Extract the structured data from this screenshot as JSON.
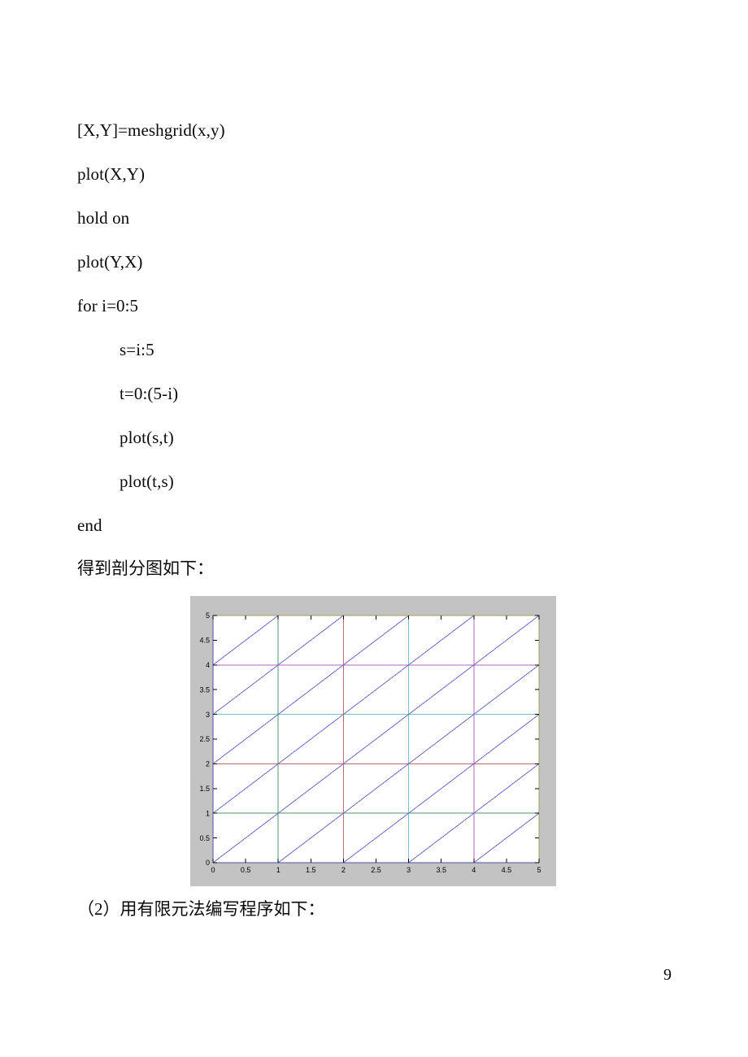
{
  "document": {
    "page_number": "9",
    "code_lines": [
      {
        "text": "[X,Y]=meshgrid(x,y)",
        "indent": 0
      },
      {
        "text": "plot(X,Y)",
        "indent": 0
      },
      {
        "text": "hold on",
        "indent": 0
      },
      {
        "text": "plot(Y,X)",
        "indent": 0
      },
      {
        "text": "for i=0:5",
        "indent": 0
      },
      {
        "text": "s=i:5",
        "indent": 1
      },
      {
        "text": "t=0:(5-i)",
        "indent": 1
      },
      {
        "text": "plot(s,t)",
        "indent": 1
      },
      {
        "text": "plot(t,s)",
        "indent": 1
      },
      {
        "text": "end",
        "indent": 0
      }
    ],
    "caption_above_figure": "得到剖分图如下：",
    "caption_below_figure": "（2）用有限元法编写程序如下："
  },
  "chart_data": {
    "type": "line",
    "title": "",
    "xlabel": "",
    "ylabel": "",
    "xlim": [
      0,
      5
    ],
    "ylim": [
      0,
      5
    ],
    "grid": false,
    "legend": false,
    "xticks": [
      "0",
      "0.5",
      "1",
      "1.5",
      "2",
      "2.5",
      "3",
      "3.5",
      "4",
      "4.5",
      "5"
    ],
    "yticks": [
      "0",
      "0.5",
      "1",
      "1.5",
      "2",
      "2.5",
      "3",
      "3.5",
      "4",
      "4.5",
      "5"
    ],
    "xtick_values": [
      0,
      0.5,
      1,
      1.5,
      2,
      2.5,
      3,
      3.5,
      4,
      4.5,
      5
    ],
    "ytick_values": [
      0,
      0.5,
      1,
      1.5,
      2,
      2.5,
      3,
      3.5,
      4,
      4.5,
      5
    ],
    "figure_background": "#c3c3c3",
    "axes_background": "#ffffff",
    "axes_edge_color": "#000000",
    "tick_label_color": "#000000",
    "matlab_color_order": [
      "#0000ff",
      "#008000",
      "#ff0000",
      "#00bfbf",
      "#bf00bf",
      "#bfbf00"
    ],
    "series": [
      {
        "name": "vertical-x0",
        "x": [
          0,
          0
        ],
        "y": [
          0,
          5
        ],
        "color": "#6a6ad0"
      },
      {
        "name": "vertical-x1",
        "x": [
          1,
          1
        ],
        "y": [
          0,
          5
        ],
        "color": "#4f9a6a"
      },
      {
        "name": "vertical-x2",
        "x": [
          2,
          2
        ],
        "y": [
          0,
          5
        ],
        "color": "#c46a6a"
      },
      {
        "name": "vertical-x3",
        "x": [
          3,
          3
        ],
        "y": [
          0,
          5
        ],
        "color": "#6fc6ce"
      },
      {
        "name": "vertical-x4",
        "x": [
          4,
          4
        ],
        "y": [
          0,
          5
        ],
        "color": "#b763bf"
      },
      {
        "name": "vertical-x5",
        "x": [
          5,
          5
        ],
        "y": [
          0,
          5
        ],
        "color": "#cfcf73"
      },
      {
        "name": "horizontal-y0",
        "x": [
          0,
          5
        ],
        "y": [
          0,
          0
        ],
        "color": "#6a6ad0"
      },
      {
        "name": "horizontal-y1",
        "x": [
          0,
          5
        ],
        "y": [
          1,
          1
        ],
        "color": "#4f9a6a"
      },
      {
        "name": "horizontal-y2",
        "x": [
          0,
          5
        ],
        "y": [
          2,
          2
        ],
        "color": "#c46a6a"
      },
      {
        "name": "horizontal-y3",
        "x": [
          0,
          5
        ],
        "y": [
          3,
          3
        ],
        "color": "#6fc6ce"
      },
      {
        "name": "horizontal-y4",
        "x": [
          0,
          5
        ],
        "y": [
          4,
          4
        ],
        "color": "#b763bf"
      },
      {
        "name": "horizontal-y5",
        "x": [
          0,
          5
        ],
        "y": [
          5,
          5
        ],
        "color": "#cfcf73"
      },
      {
        "name": "diagonal-i0",
        "x": [
          0,
          5
        ],
        "y": [
          0,
          5
        ],
        "color": "#6a6ad0"
      },
      {
        "name": "diagonal-i1-upper",
        "x": [
          0,
          4
        ],
        "y": [
          1,
          5
        ],
        "color": "#6a6ad0"
      },
      {
        "name": "diagonal-i1-lower",
        "x": [
          1,
          5
        ],
        "y": [
          0,
          4
        ],
        "color": "#6a6ad0"
      },
      {
        "name": "diagonal-i2-upper",
        "x": [
          0,
          3
        ],
        "y": [
          2,
          5
        ],
        "color": "#6a6ad0"
      },
      {
        "name": "diagonal-i2-lower",
        "x": [
          2,
          5
        ],
        "y": [
          0,
          3
        ],
        "color": "#6a6ad0"
      },
      {
        "name": "diagonal-i3-upper",
        "x": [
          0,
          2
        ],
        "y": [
          3,
          5
        ],
        "color": "#6a6ad0"
      },
      {
        "name": "diagonal-i3-lower",
        "x": [
          3,
          5
        ],
        "y": [
          0,
          2
        ],
        "color": "#6a6ad0"
      },
      {
        "name": "diagonal-i4-upper",
        "x": [
          0,
          1
        ],
        "y": [
          4,
          5
        ],
        "color": "#6a6ad0"
      },
      {
        "name": "diagonal-i4-lower",
        "x": [
          4,
          5
        ],
        "y": [
          0,
          1
        ],
        "color": "#6a6ad0"
      }
    ]
  }
}
